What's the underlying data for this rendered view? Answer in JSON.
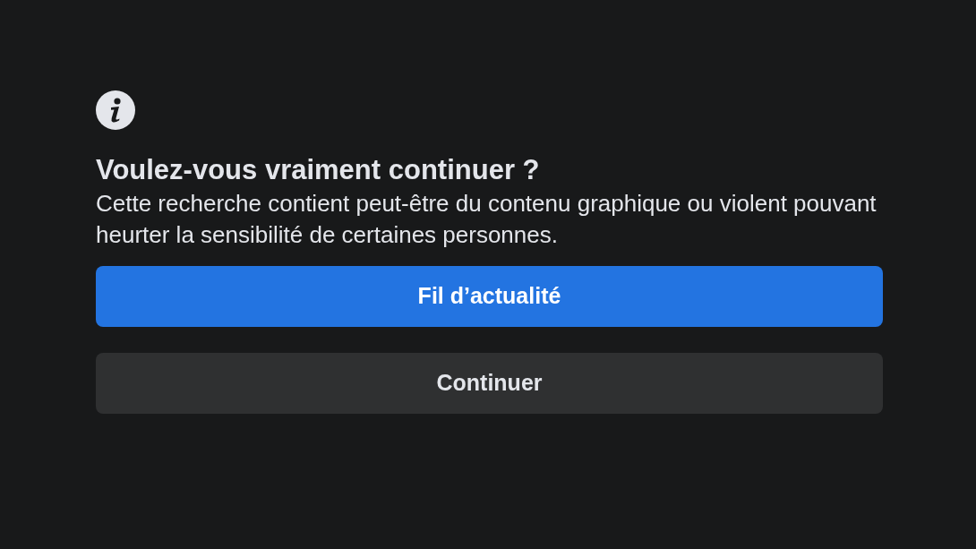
{
  "dialog": {
    "title": "Voulez-vous vraiment continuer ?",
    "message": "Cette recherche contient peut-être du contenu graphique ou violent pouvant heurter la sensibilité de certaines personnes.",
    "buttons": [
      {
        "label": "Fil d’actualité",
        "kind": "primary"
      },
      {
        "label": "Continuer",
        "kind": "secondary"
      }
    ]
  }
}
